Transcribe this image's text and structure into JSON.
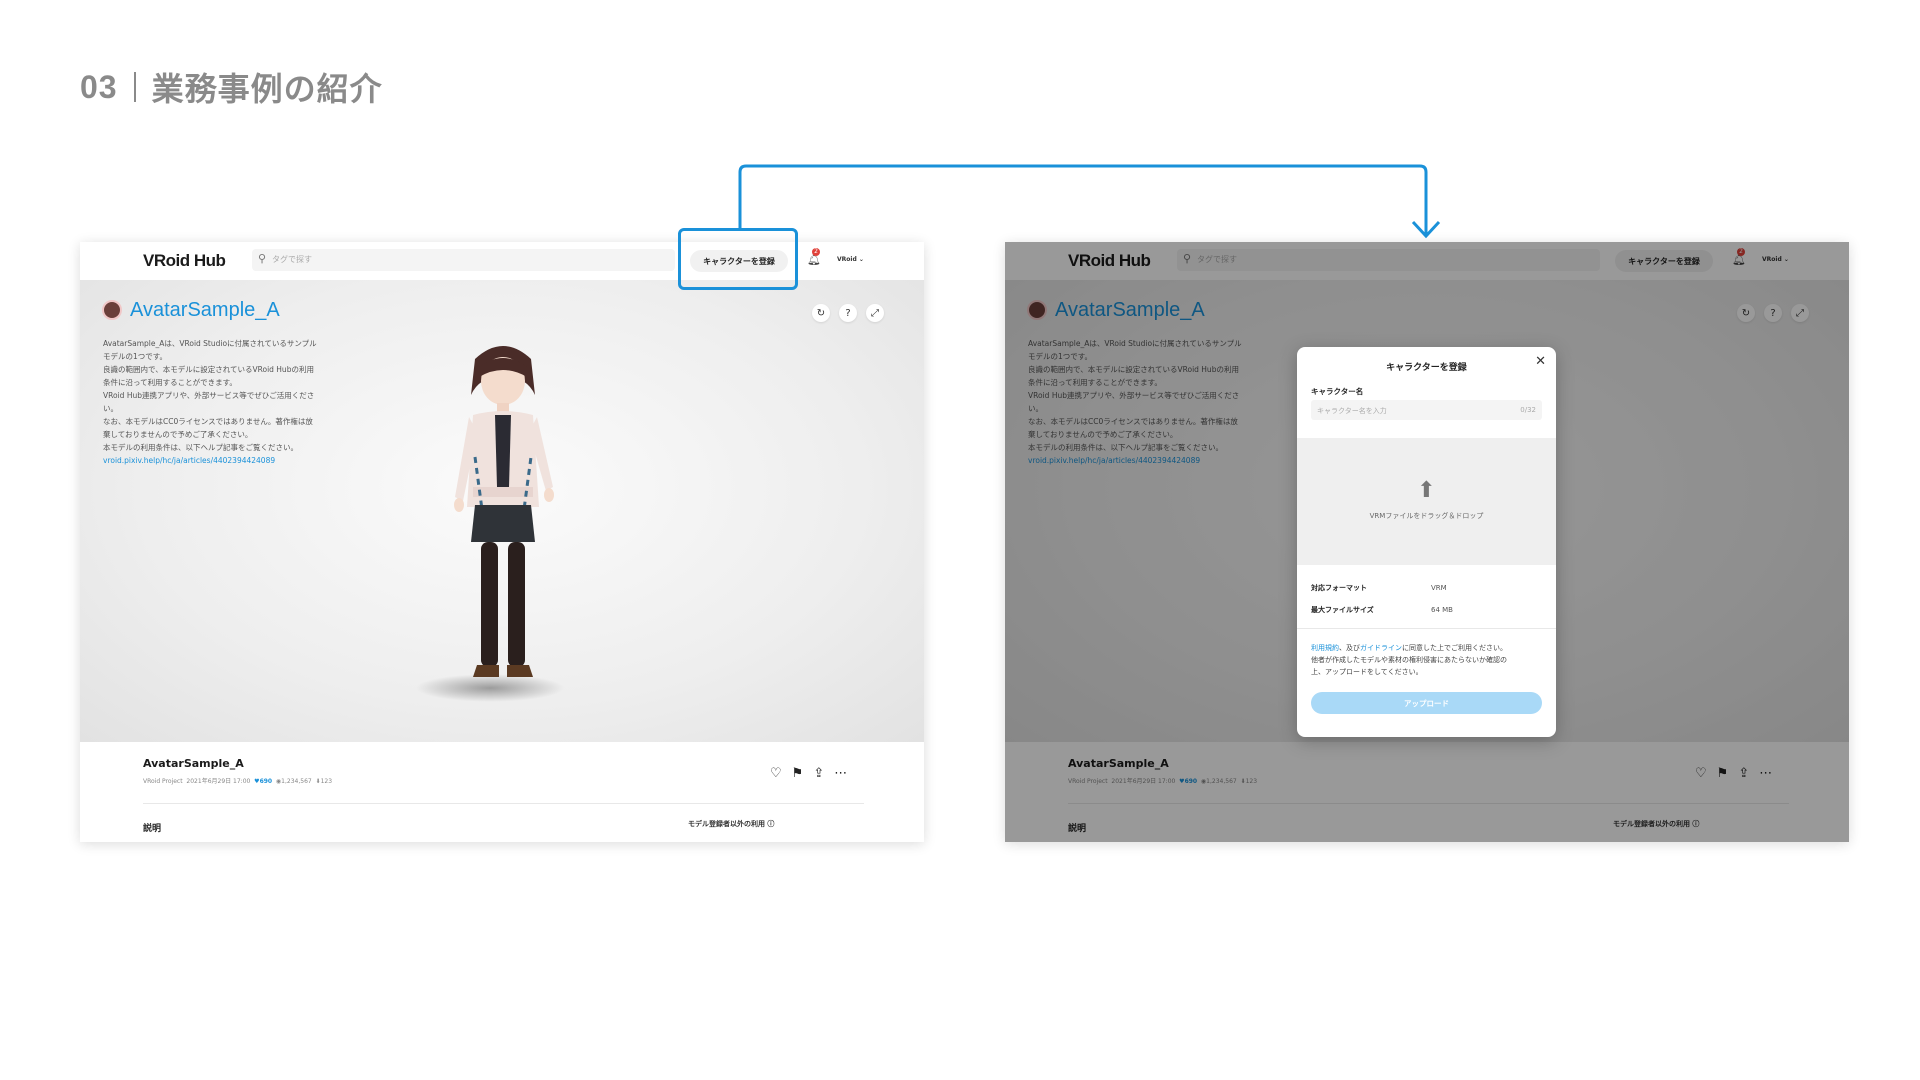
{
  "slide": {
    "number": "03",
    "title": "業務事例の紹介"
  },
  "header": {
    "logo": "VRoid Hub",
    "search_placeholder": "タグで探す",
    "register_button": "キャラクターを登録",
    "notification_count": "2",
    "user_label": "VRoid"
  },
  "model": {
    "title": "AvatarSample_A",
    "description_lines": [
      "AvatarSample_Aは、VRoid Studioに付属されているサンプル",
      "モデルの1つです。",
      "良識の範囲内で、本モデルに設定されているVRoid Hubの利用",
      "条件に沿って利用することができます。",
      "VRoid Hub連携アプリや、外部サービス等でぜひご活用くださ",
      "い。",
      "なお、本モデルはCC0ライセンスではありません。著作権は放",
      "棄しておりませんので予めご了承ください。",
      "本モデルの利用条件は、以下ヘルプ記事をご覧ください。"
    ],
    "help_link": "vroid.pixiv.help/hc/ja/articles/4402394424089",
    "controls": [
      "↻",
      "?",
      "⤢"
    ]
  },
  "footer": {
    "name": "AvatarSample_A",
    "author": "VRoid Project",
    "date": "2021年6月29日 17:00",
    "likes": "690",
    "views": "1,234,567",
    "downloads": "123",
    "description_heading": "説明",
    "usage_label": "モデル登録者以外の利用 ⓘ"
  },
  "modal": {
    "title": "キャラクターを登録",
    "name_label": "キャラクター名",
    "name_placeholder": "キャラクター名を入力",
    "name_counter": "0/32",
    "drop_text": "VRMファイルをドラッグ＆ドロップ",
    "format_label": "対応フォーマット",
    "format_value": "VRM",
    "size_label": "最大ファイルサイズ",
    "size_value": "64 MB",
    "terms_link1": "利用規約",
    "terms_mid": "、及び",
    "terms_link2": "ガイドライン",
    "terms_line1_rest": "に同意した上でご利用ください。",
    "terms_line2": "他者が作成したモデルや素材の権利侵害にあたらないか確認の",
    "terms_line3": "上、アップロードをしてください。",
    "upload_button": "アップロード"
  },
  "colors": {
    "accent": "#1a91d9",
    "title_gray": "#8a8a8a",
    "upload_disabled": "#a9d9f7",
    "badge": "#e0413a"
  },
  "icons": [
    "search-icon",
    "bell-icon",
    "reload-icon",
    "help-icon",
    "fullscreen-icon",
    "heart-icon",
    "bookmark-icon",
    "share-icon",
    "more-icon",
    "close-icon",
    "upload-arrow-icon",
    "info-icon"
  ]
}
